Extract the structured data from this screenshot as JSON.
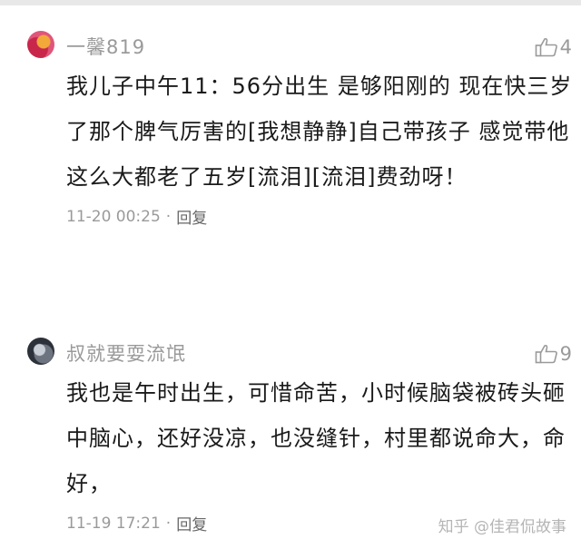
{
  "comments": [
    {
      "username": "一馨819",
      "likes": "4",
      "text": "我儿子中午11：56分出生 是够阳刚的 现在快三岁了那个脾气厉害的[我想静静]自己带孩子 感觉带他这么大都老了五岁[流泪][流泪]费劲呀！",
      "time": "11-20 00:25",
      "dot": "·",
      "reply": "回复"
    },
    {
      "username": "叔就要耍流氓",
      "likes": "9",
      "text": "我也是午时出生，可惜命苦，小时候脑袋被砖头砸中脑心，还好没凉，也没缝针，村里都说命大，命好，",
      "time": "11-19 17:21",
      "dot": "·",
      "reply": "回复"
    }
  ],
  "watermark": "知乎 @佳君侃故事",
  "icons": {
    "like": "thumbs-up-icon"
  },
  "colors": {
    "muted": "#9a9a9a",
    "text": "#1a1a1a"
  }
}
